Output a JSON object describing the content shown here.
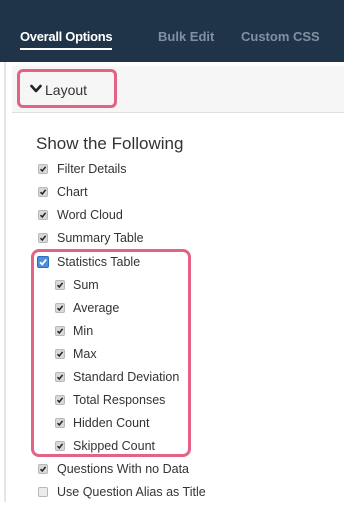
{
  "tabs": {
    "overall": "Overall Options",
    "bulk": "Bulk Edit",
    "css": "Custom CSS"
  },
  "layout": {
    "label": "Layout"
  },
  "section": {
    "title": "Show the Following"
  },
  "options": {
    "filter_details": {
      "label": "Filter Details",
      "checked": true
    },
    "chart": {
      "label": "Chart",
      "checked": true
    },
    "word_cloud": {
      "label": "Word Cloud",
      "checked": true
    },
    "summary_table": {
      "label": "Summary Table",
      "checked": true
    },
    "statistics_table": {
      "label": "Statistics Table",
      "checked": true
    },
    "sum": {
      "label": "Sum",
      "checked": true
    },
    "average": {
      "label": "Average",
      "checked": true
    },
    "min": {
      "label": "Min",
      "checked": true
    },
    "max": {
      "label": "Max",
      "checked": true
    },
    "standard_deviation": {
      "label": "Standard Deviation",
      "checked": true
    },
    "total_responses": {
      "label": "Total Responses",
      "checked": true
    },
    "hidden_count": {
      "label": "Hidden Count",
      "checked": true
    },
    "skipped_count": {
      "label": "Skipped Count",
      "checked": true
    },
    "questions_no_data": {
      "label": "Questions With no Data",
      "checked": true
    },
    "use_alias": {
      "label": "Use Question Alias as Title",
      "checked": false
    }
  },
  "colors": {
    "tab_bar": "#1f3448",
    "highlight": "#e26383",
    "checkbox_focus": "#4c8fdc"
  }
}
